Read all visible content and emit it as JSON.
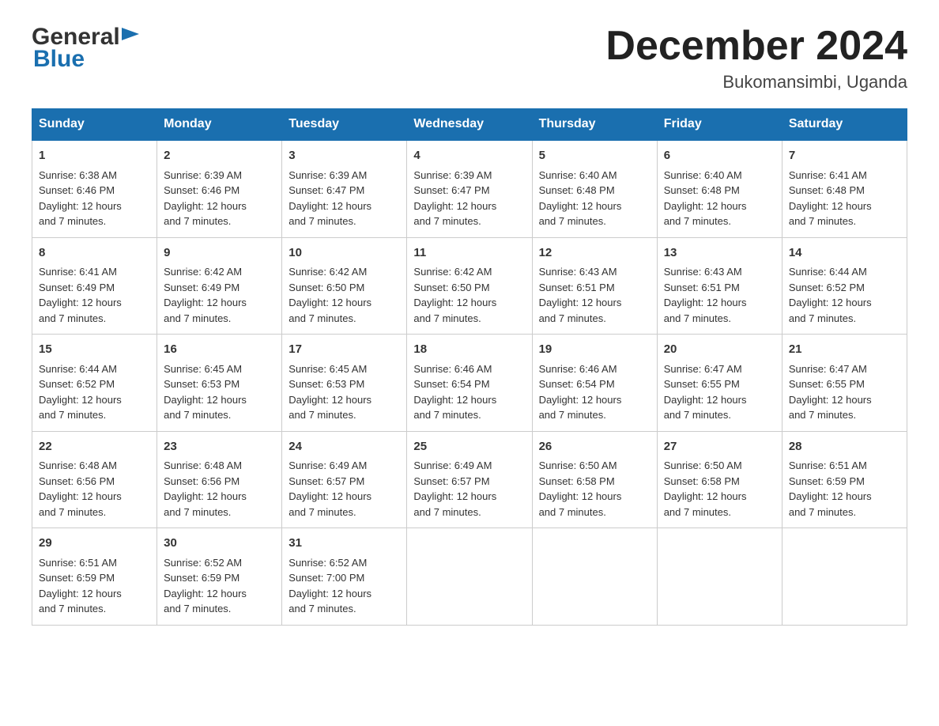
{
  "header": {
    "logo_general": "General",
    "logo_blue": "Blue",
    "month_year": "December 2024",
    "location": "Bukomansimbi, Uganda"
  },
  "days_of_week": [
    "Sunday",
    "Monday",
    "Tuesday",
    "Wednesday",
    "Thursday",
    "Friday",
    "Saturday"
  ],
  "weeks": [
    [
      {
        "day": "1",
        "sunrise": "6:38 AM",
        "sunset": "6:46 PM",
        "daylight": "12 hours and 7 minutes."
      },
      {
        "day": "2",
        "sunrise": "6:39 AM",
        "sunset": "6:46 PM",
        "daylight": "12 hours and 7 minutes."
      },
      {
        "day": "3",
        "sunrise": "6:39 AM",
        "sunset": "6:47 PM",
        "daylight": "12 hours and 7 minutes."
      },
      {
        "day": "4",
        "sunrise": "6:39 AM",
        "sunset": "6:47 PM",
        "daylight": "12 hours and 7 minutes."
      },
      {
        "day": "5",
        "sunrise": "6:40 AM",
        "sunset": "6:48 PM",
        "daylight": "12 hours and 7 minutes."
      },
      {
        "day": "6",
        "sunrise": "6:40 AM",
        "sunset": "6:48 PM",
        "daylight": "12 hours and 7 minutes."
      },
      {
        "day": "7",
        "sunrise": "6:41 AM",
        "sunset": "6:48 PM",
        "daylight": "12 hours and 7 minutes."
      }
    ],
    [
      {
        "day": "8",
        "sunrise": "6:41 AM",
        "sunset": "6:49 PM",
        "daylight": "12 hours and 7 minutes."
      },
      {
        "day": "9",
        "sunrise": "6:42 AM",
        "sunset": "6:49 PM",
        "daylight": "12 hours and 7 minutes."
      },
      {
        "day": "10",
        "sunrise": "6:42 AM",
        "sunset": "6:50 PM",
        "daylight": "12 hours and 7 minutes."
      },
      {
        "day": "11",
        "sunrise": "6:42 AM",
        "sunset": "6:50 PM",
        "daylight": "12 hours and 7 minutes."
      },
      {
        "day": "12",
        "sunrise": "6:43 AM",
        "sunset": "6:51 PM",
        "daylight": "12 hours and 7 minutes."
      },
      {
        "day": "13",
        "sunrise": "6:43 AM",
        "sunset": "6:51 PM",
        "daylight": "12 hours and 7 minutes."
      },
      {
        "day": "14",
        "sunrise": "6:44 AM",
        "sunset": "6:52 PM",
        "daylight": "12 hours and 7 minutes."
      }
    ],
    [
      {
        "day": "15",
        "sunrise": "6:44 AM",
        "sunset": "6:52 PM",
        "daylight": "12 hours and 7 minutes."
      },
      {
        "day": "16",
        "sunrise": "6:45 AM",
        "sunset": "6:53 PM",
        "daylight": "12 hours and 7 minutes."
      },
      {
        "day": "17",
        "sunrise": "6:45 AM",
        "sunset": "6:53 PM",
        "daylight": "12 hours and 7 minutes."
      },
      {
        "day": "18",
        "sunrise": "6:46 AM",
        "sunset": "6:54 PM",
        "daylight": "12 hours and 7 minutes."
      },
      {
        "day": "19",
        "sunrise": "6:46 AM",
        "sunset": "6:54 PM",
        "daylight": "12 hours and 7 minutes."
      },
      {
        "day": "20",
        "sunrise": "6:47 AM",
        "sunset": "6:55 PM",
        "daylight": "12 hours and 7 minutes."
      },
      {
        "day": "21",
        "sunrise": "6:47 AM",
        "sunset": "6:55 PM",
        "daylight": "12 hours and 7 minutes."
      }
    ],
    [
      {
        "day": "22",
        "sunrise": "6:48 AM",
        "sunset": "6:56 PM",
        "daylight": "12 hours and 7 minutes."
      },
      {
        "day": "23",
        "sunrise": "6:48 AM",
        "sunset": "6:56 PM",
        "daylight": "12 hours and 7 minutes."
      },
      {
        "day": "24",
        "sunrise": "6:49 AM",
        "sunset": "6:57 PM",
        "daylight": "12 hours and 7 minutes."
      },
      {
        "day": "25",
        "sunrise": "6:49 AM",
        "sunset": "6:57 PM",
        "daylight": "12 hours and 7 minutes."
      },
      {
        "day": "26",
        "sunrise": "6:50 AM",
        "sunset": "6:58 PM",
        "daylight": "12 hours and 7 minutes."
      },
      {
        "day": "27",
        "sunrise": "6:50 AM",
        "sunset": "6:58 PM",
        "daylight": "12 hours and 7 minutes."
      },
      {
        "day": "28",
        "sunrise": "6:51 AM",
        "sunset": "6:59 PM",
        "daylight": "12 hours and 7 minutes."
      }
    ],
    [
      {
        "day": "29",
        "sunrise": "6:51 AM",
        "sunset": "6:59 PM",
        "daylight": "12 hours and 7 minutes."
      },
      {
        "day": "30",
        "sunrise": "6:52 AM",
        "sunset": "6:59 PM",
        "daylight": "12 hours and 7 minutes."
      },
      {
        "day": "31",
        "sunrise": "6:52 AM",
        "sunset": "7:00 PM",
        "daylight": "12 hours and 7 minutes."
      },
      null,
      null,
      null,
      null
    ]
  ],
  "labels": {
    "sunrise": "Sunrise:",
    "sunset": "Sunset:",
    "daylight": "Daylight:"
  }
}
